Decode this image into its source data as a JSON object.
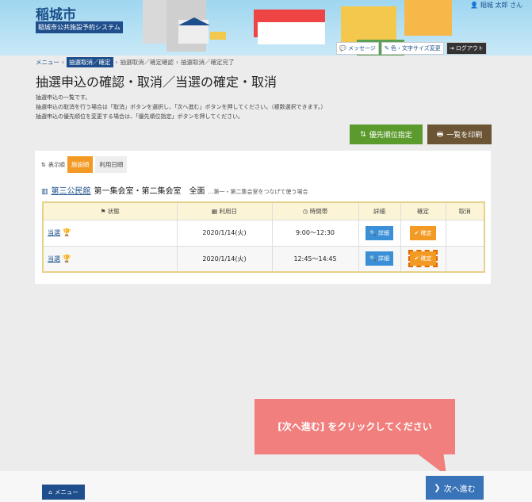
{
  "header": {
    "city": "稲城市",
    "system": "稲城市公共施設予約システム",
    "user": "稲城 太郎 さん",
    "links": [
      "メッセージ",
      "色・文字サイズ変更"
    ],
    "logout": "ログアウト"
  },
  "breadcrumb": [
    "メニュー",
    "抽選取消／確定",
    "抽選取消／確定確認",
    "抽選取消／確定完了"
  ],
  "page": {
    "title": "抽選申込の確認・取消／当選の確定・取消",
    "desc": [
      "抽選申込の一覧です。",
      "抽選申込の取消を行う場合は「取消」ボタンを選択し、「次へ進む」ボタンを押してください。（複数選択できます。）",
      "抽選申込の優先順位を変更する場合は、「優先順位指定」ボタンを押してください。"
    ]
  },
  "buttons": {
    "priority": "優先順位指定",
    "print": "一覧を印刷",
    "menu": "メニュー",
    "next": "次へ進む"
  },
  "sort": {
    "label": "表示順",
    "tabs": [
      "施設順",
      "利用日順"
    ]
  },
  "facility": {
    "name": "第三公民館",
    "room": "第一集会室・第二集会室　全面",
    "note": "…第一・第二集会室をつなげて使う場合"
  },
  "table": {
    "headers": [
      "状態",
      "利用日",
      "時間帯",
      "詳細",
      "確定",
      "取消"
    ],
    "rows": [
      {
        "status": "当選",
        "date": "2020/1/14(火)",
        "time": "9:00～12:30",
        "detail": "詳細",
        "confirm": "確定"
      },
      {
        "status": "当選",
        "date": "2020/1/14(火)",
        "time": "12:45～14:45",
        "detail": "詳細",
        "confirm": "確定"
      }
    ]
  },
  "tooltip": "[次へ進む] をクリックしてください",
  "colors": {
    "accent": "#f39a24",
    "brand": "#1f4e8c",
    "tooltip": "#f07f7d"
  }
}
